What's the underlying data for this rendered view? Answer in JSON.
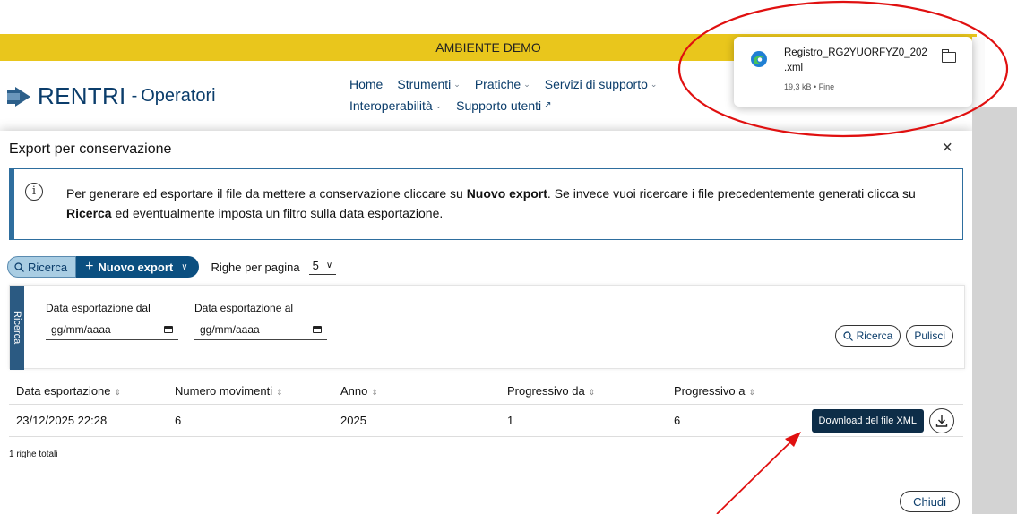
{
  "app": {
    "environment_banner": "AMBIENTE DEMO",
    "brand_name": "RENTRI",
    "brand_separator": "-",
    "brand_sub": "Operatori",
    "nav_row1": [
      {
        "label": "Home",
        "has_caret": false
      },
      {
        "label": "Strumenti",
        "has_caret": true
      },
      {
        "label": "Pratiche",
        "has_caret": true
      },
      {
        "label": "Servizi di supporto",
        "has_caret": true
      }
    ],
    "nav_row2": [
      {
        "label": "Interoperabilità",
        "has_caret": true
      },
      {
        "label": "Supporto utenti",
        "has_caret": false
      }
    ]
  },
  "modal": {
    "title": "Export per conservazione",
    "close_glyph": "×",
    "info": {
      "p1": "Per generare ed esportare il file da mettere a conservazione cliccare su ",
      "b1": "Nuovo export",
      "p2": ". Se invece vuoi ricercare i file precedentemente generati clicca su ",
      "b2": "Ricerca",
      "p3": " ed eventualmente imposta un filtro sulla data esportazione."
    },
    "toolbar": {
      "ricerca_label": "Ricerca",
      "nuovo_label": "Nuovo export",
      "righe_label": "Righe per pagina",
      "righe_value": "5"
    },
    "filter": {
      "tab_label": "Ricerca",
      "from_label": "Data esportazione dal",
      "from_placeholder": "gg/mm/aaaa",
      "to_label": "Data esportazione al",
      "to_placeholder": "gg/mm/aaaa",
      "search_button": "Ricerca",
      "clear_button": "Pulisci"
    },
    "table": {
      "columns": [
        "Data esportazione",
        "Numero movimenti",
        "Anno",
        "Progressivo da",
        "Progressivo a"
      ],
      "rows": [
        {
          "data": "23/12/2025 22:28",
          "movimenti": "6",
          "anno": "2025",
          "da": "1",
          "a": "6",
          "download_label": "Download del file XML"
        }
      ],
      "total_text": "1 righe totali"
    },
    "close_button": "Chiudi"
  },
  "download_popup": {
    "filename_line1": "Registro_RG2YUORFYZ0_202",
    "filename_line2": ".xml",
    "meta": "19,3 kB • Fine"
  },
  "colors": {
    "banner": "#e9c61c",
    "brand_blue": "#0b3d6b",
    "primary_button": "#0b4f80",
    "download_button": "#0d2d48",
    "annotation_red": "#e01010"
  }
}
